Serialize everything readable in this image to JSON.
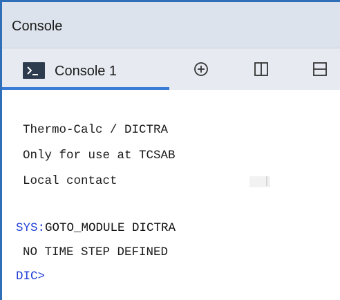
{
  "window": {
    "title": "Console"
  },
  "tabs": [
    {
      "label": "Console 1",
      "active": true,
      "icon": "console-prompt-icon"
    }
  ],
  "toolbar": {
    "add_icon": "circle-plus-icon",
    "split_vertical_icon": "split-vertical-icon",
    "split_horizontal_icon": "split-horizontal-icon"
  },
  "console": {
    "lines": [
      {
        "text": "Thermo-Calc / DICTRA"
      },
      {
        "text": "Only for use at TCSAB"
      },
      {
        "text": "Local contact"
      }
    ],
    "command": {
      "prompt": "SYS:",
      "text": "GOTO_MODULE DICTRA"
    },
    "response": "NO TIME STEP DEFINED",
    "current_prompt": "DIC>"
  },
  "colors": {
    "accent": "#3a7bd5",
    "border": "#2f6fb8",
    "prompt": "#1f3fd6",
    "title_bar_bg": "#dde3ec",
    "tab_bar_bg": "#e7ebf1"
  }
}
